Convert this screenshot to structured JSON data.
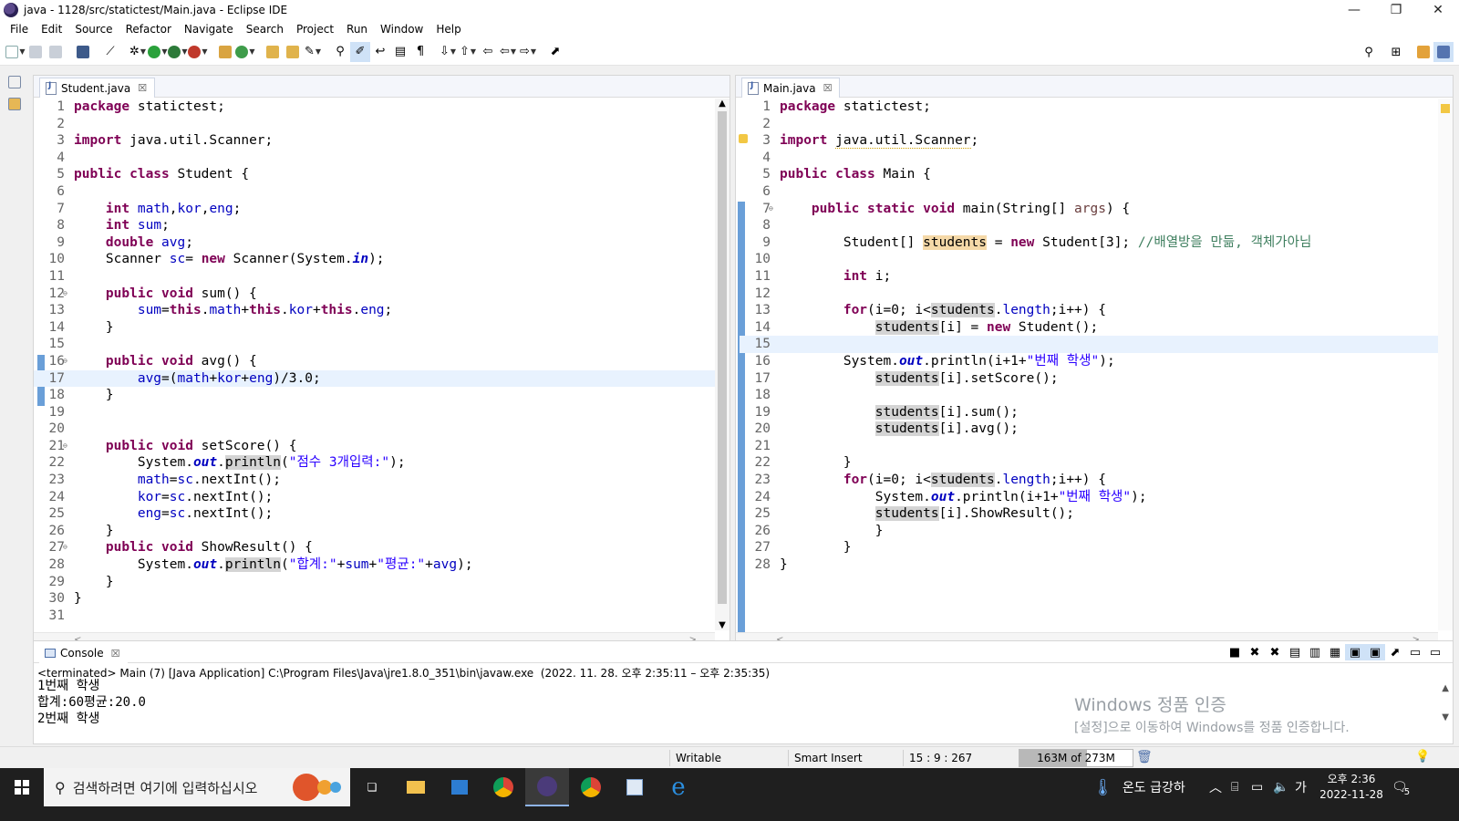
{
  "window": {
    "title": "java - 1128/src/statictest/Main.java - Eclipse IDE",
    "minimize": "—",
    "maximize": "❐",
    "close": "✕"
  },
  "menu": [
    "File",
    "Edit",
    "Source",
    "Refactor",
    "Navigate",
    "Search",
    "Project",
    "Run",
    "Window",
    "Help"
  ],
  "editors": {
    "left": {
      "tab_label": "Student.java",
      "tab_close": "☒",
      "lines": [
        {
          "n": "1",
          "s": [
            [
              "kw",
              "package"
            ],
            [
              "t",
              " statictest;"
            ]
          ]
        },
        {
          "n": "2",
          "s": []
        },
        {
          "n": "3",
          "s": [
            [
              "kw",
              "import"
            ],
            [
              "t",
              " java.util.Scanner;"
            ]
          ]
        },
        {
          "n": "4",
          "s": []
        },
        {
          "n": "5",
          "s": [
            [
              "kw",
              "public class"
            ],
            [
              "t",
              " Student {"
            ]
          ]
        },
        {
          "n": "6",
          "s": []
        },
        {
          "n": "7",
          "s": [
            [
              "t",
              "    "
            ],
            [
              "kw",
              "int"
            ],
            [
              "t",
              " "
            ],
            [
              "fld",
              "math"
            ],
            [
              "t",
              ","
            ],
            [
              "fld",
              "kor"
            ],
            [
              "t",
              ","
            ],
            [
              "fld",
              "eng"
            ],
            [
              "t",
              ";"
            ]
          ]
        },
        {
          "n": "8",
          "s": [
            [
              "t",
              "    "
            ],
            [
              "kw",
              "int"
            ],
            [
              "t",
              " "
            ],
            [
              "fld",
              "sum"
            ],
            [
              "t",
              ";"
            ]
          ]
        },
        {
          "n": "9",
          "s": [
            [
              "t",
              "    "
            ],
            [
              "kw",
              "double"
            ],
            [
              "t",
              " "
            ],
            [
              "fld",
              "avg"
            ],
            [
              "t",
              ";"
            ]
          ]
        },
        {
          "n": "10",
          "s": [
            [
              "t",
              "    Scanner "
            ],
            [
              "fld",
              "sc"
            ],
            [
              "t",
              "= "
            ],
            [
              "kw",
              "new"
            ],
            [
              "t",
              " Scanner(System."
            ],
            [
              "sfld",
              "in"
            ],
            [
              "t",
              ");"
            ]
          ]
        },
        {
          "n": "11",
          "s": []
        },
        {
          "n": "12",
          "f": "⊖",
          "s": [
            [
              "t",
              "    "
            ],
            [
              "kw",
              "public void"
            ],
            [
              "t",
              " sum() {"
            ]
          ]
        },
        {
          "n": "13",
          "s": [
            [
              "t",
              "        "
            ],
            [
              "fld",
              "sum"
            ],
            [
              "t",
              "="
            ],
            [
              "kw",
              "this"
            ],
            [
              "t",
              "."
            ],
            [
              "fld",
              "math"
            ],
            [
              "t",
              "+"
            ],
            [
              "kw",
              "this"
            ],
            [
              "t",
              "."
            ],
            [
              "fld",
              "kor"
            ],
            [
              "t",
              "+"
            ],
            [
              "kw",
              "this"
            ],
            [
              "t",
              "."
            ],
            [
              "fld",
              "eng"
            ],
            [
              "t",
              ";"
            ]
          ]
        },
        {
          "n": "14",
          "s": [
            [
              "t",
              "    }"
            ]
          ]
        },
        {
          "n": "15",
          "s": []
        },
        {
          "n": "16",
          "f": "⊖",
          "s": [
            [
              "t",
              "    "
            ],
            [
              "kw",
              "public void"
            ],
            [
              "t",
              " avg() {"
            ]
          ]
        },
        {
          "n": "17",
          "cur": true,
          "s": [
            [
              "t",
              "        "
            ],
            [
              "fld",
              "avg"
            ],
            [
              "t",
              "=("
            ],
            [
              "fld",
              "math"
            ],
            [
              "t",
              "+"
            ],
            [
              "fld",
              "kor"
            ],
            [
              "t",
              "+"
            ],
            [
              "fld",
              "eng"
            ],
            [
              "t",
              ")/3.0;"
            ]
          ]
        },
        {
          "n": "18",
          "s": [
            [
              "t",
              "    }"
            ]
          ]
        },
        {
          "n": "19",
          "s": []
        },
        {
          "n": "20",
          "s": []
        },
        {
          "n": "21",
          "f": "⊖",
          "s": [
            [
              "t",
              "    "
            ],
            [
              "kw",
              "public void"
            ],
            [
              "t",
              " setScore() {"
            ]
          ]
        },
        {
          "n": "22",
          "s": [
            [
              "t",
              "        System."
            ],
            [
              "sfld",
              "out"
            ],
            [
              "t",
              "."
            ],
            [
              "occ",
              "println"
            ],
            [
              "t",
              "("
            ],
            [
              "str",
              "\"점수 3개입력:\""
            ],
            [
              "t",
              ");"
            ]
          ]
        },
        {
          "n": "23",
          "s": [
            [
              "t",
              "        "
            ],
            [
              "fld",
              "math"
            ],
            [
              "t",
              "="
            ],
            [
              "fld",
              "sc"
            ],
            [
              "t",
              ".nextInt();"
            ]
          ]
        },
        {
          "n": "24",
          "s": [
            [
              "t",
              "        "
            ],
            [
              "fld",
              "kor"
            ],
            [
              "t",
              "="
            ],
            [
              "fld",
              "sc"
            ],
            [
              "t",
              ".nextInt();"
            ]
          ]
        },
        {
          "n": "25",
          "s": [
            [
              "t",
              "        "
            ],
            [
              "fld",
              "eng"
            ],
            [
              "t",
              "="
            ],
            [
              "fld",
              "sc"
            ],
            [
              "t",
              ".nextInt();"
            ]
          ]
        },
        {
          "n": "26",
          "s": [
            [
              "t",
              "    }"
            ]
          ]
        },
        {
          "n": "27",
          "f": "⊖",
          "s": [
            [
              "t",
              "    "
            ],
            [
              "kw",
              "public void"
            ],
            [
              "t",
              " ShowResult() {"
            ]
          ]
        },
        {
          "n": "28",
          "s": [
            [
              "t",
              "        System."
            ],
            [
              "sfld",
              "out"
            ],
            [
              "t",
              "."
            ],
            [
              "occ",
              "println"
            ],
            [
              "t",
              "("
            ],
            [
              "str",
              "\"합계:\""
            ],
            [
              "t",
              "+"
            ],
            [
              "fld",
              "sum"
            ],
            [
              "t",
              "+"
            ],
            [
              "str",
              "\"평균:\""
            ],
            [
              "t",
              "+"
            ],
            [
              "fld",
              "avg"
            ],
            [
              "t",
              ");"
            ]
          ]
        },
        {
          "n": "29",
          "s": [
            [
              "t",
              "    }"
            ]
          ]
        },
        {
          "n": "30",
          "s": [
            [
              "t",
              "}"
            ]
          ]
        },
        {
          "n": "31",
          "s": []
        }
      ]
    },
    "right": {
      "tab_label": "Main.java",
      "tab_close": "☒",
      "lines": [
        {
          "n": "1",
          "s": [
            [
              "kw",
              "package"
            ],
            [
              "t",
              " statictest;"
            ]
          ]
        },
        {
          "n": "2",
          "s": []
        },
        {
          "n": "3",
          "s": [
            [
              "kw",
              "import"
            ],
            [
              "t",
              " "
            ],
            [
              "warn",
              "java.util.Scanner"
            ],
            [
              "t",
              ";"
            ]
          ]
        },
        {
          "n": "4",
          "s": []
        },
        {
          "n": "5",
          "s": [
            [
              "kw",
              "public class"
            ],
            [
              "t",
              " Main {"
            ]
          ]
        },
        {
          "n": "6",
          "s": []
        },
        {
          "n": "7",
          "f": "⊖",
          "s": [
            [
              "t",
              "    "
            ],
            [
              "kw",
              "public static void"
            ],
            [
              "t",
              " main(String[] "
            ],
            [
              "par",
              "args"
            ],
            [
              "t",
              ") {"
            ]
          ]
        },
        {
          "n": "8",
          "s": []
        },
        {
          "n": "9",
          "s": [
            [
              "t",
              "        Student[] "
            ],
            [
              "occ2",
              "students"
            ],
            [
              "t",
              " = "
            ],
            [
              "kw",
              "new"
            ],
            [
              "t",
              " Student[3]; "
            ],
            [
              "cmt",
              "//배열방을 만듦, 객체가아님"
            ]
          ]
        },
        {
          "n": "10",
          "s": []
        },
        {
          "n": "11",
          "s": [
            [
              "t",
              "        "
            ],
            [
              "kw",
              "int"
            ],
            [
              "t",
              " i;"
            ]
          ]
        },
        {
          "n": "12",
          "s": []
        },
        {
          "n": "13",
          "s": [
            [
              "t",
              "        "
            ],
            [
              "kw",
              "for"
            ],
            [
              "t",
              "(i=0; i<"
            ],
            [
              "occ",
              "students"
            ],
            [
              "t",
              "."
            ],
            [
              "fld",
              "length"
            ],
            [
              "t",
              ";i++) {"
            ]
          ]
        },
        {
          "n": "14",
          "s": [
            [
              "t",
              "            "
            ],
            [
              "occ",
              "students"
            ],
            [
              "t",
              "[i] = "
            ],
            [
              "kw",
              "new"
            ],
            [
              "t",
              " Student();"
            ]
          ]
        },
        {
          "n": "15",
          "cur": true,
          "s": []
        },
        {
          "n": "16",
          "s": [
            [
              "t",
              "        System."
            ],
            [
              "sfld",
              "out"
            ],
            [
              "t",
              ".println(i+1+"
            ],
            [
              "str",
              "\"번째 학생\""
            ],
            [
              "t",
              ");"
            ]
          ]
        },
        {
          "n": "17",
          "s": [
            [
              "t",
              "            "
            ],
            [
              "occ",
              "students"
            ],
            [
              "t",
              "[i].setScore();"
            ]
          ]
        },
        {
          "n": "18",
          "s": []
        },
        {
          "n": "19",
          "s": [
            [
              "t",
              "            "
            ],
            [
              "occ",
              "students"
            ],
            [
              "t",
              "[i].sum();"
            ]
          ]
        },
        {
          "n": "20",
          "s": [
            [
              "t",
              "            "
            ],
            [
              "occ",
              "students"
            ],
            [
              "t",
              "[i].avg();"
            ]
          ]
        },
        {
          "n": "21",
          "s": []
        },
        {
          "n": "22",
          "s": [
            [
              "t",
              "        }"
            ]
          ]
        },
        {
          "n": "23",
          "s": [
            [
              "t",
              "        "
            ],
            [
              "kw",
              "for"
            ],
            [
              "t",
              "(i=0; i<"
            ],
            [
              "occ",
              "students"
            ],
            [
              "t",
              "."
            ],
            [
              "fld",
              "length"
            ],
            [
              "t",
              ";i++) {"
            ]
          ]
        },
        {
          "n": "24",
          "s": [
            [
              "t",
              "            System."
            ],
            [
              "sfld",
              "out"
            ],
            [
              "t",
              ".println(i+1+"
            ],
            [
              "str",
              "\"번째 학생\""
            ],
            [
              "t",
              ");"
            ]
          ]
        },
        {
          "n": "25",
          "s": [
            [
              "t",
              "            "
            ],
            [
              "occ",
              "students"
            ],
            [
              "t",
              "[i].ShowResult();"
            ]
          ]
        },
        {
          "n": "26",
          "s": [
            [
              "t",
              "            }"
            ]
          ]
        },
        {
          "n": "27",
          "s": [
            [
              "t",
              "        }"
            ]
          ]
        },
        {
          "n": "28",
          "s": [
            [
              "t",
              "}"
            ]
          ]
        }
      ]
    }
  },
  "console": {
    "tab_label": "Console",
    "tab_close": "☒",
    "description": "<terminated> Main (7) [Java Application] C:\\Program Files\\Java\\jre1.8.0_351\\bin\\javaw.exe  (2022. 11. 28. 오후 2:35:11 – 오후 2:35:35)",
    "output": [
      "1번째 학생",
      "합계:60평균:20.0",
      "2번째 학생"
    ]
  },
  "watermark": {
    "line1": "Windows 정품 인증",
    "line2": "[설정]으로 이동하여 Windows를 정품 인증합니다."
  },
  "status": {
    "writable": "Writable",
    "insert_mode": "Smart Insert",
    "position": "15 : 9 : 267",
    "heap": "163M of 273M",
    "heap_used_fraction": 0.6
  },
  "taskbar": {
    "search_placeholder": "검색하려면 여기에 입력하십시오",
    "weather": "온도 급강하",
    "ime": "가",
    "time": "오후 2:36",
    "date": "2022-11-28",
    "notifications": "5"
  },
  "colors": {
    "keyword": "#7f0055",
    "string": "#2a00ff",
    "field": "#0000c0",
    "comment": "#3f7f5f",
    "current_line": "#e8f2fe"
  }
}
